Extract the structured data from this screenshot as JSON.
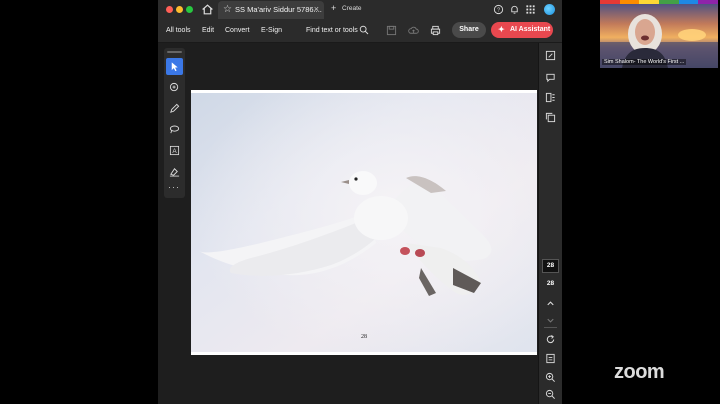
{
  "window": {
    "tab_title": "SS Ma'ariv Siddur 5786....",
    "create_label": "Create"
  },
  "toolbar": {
    "menus": [
      "All tools",
      "Edit",
      "Convert",
      "E-Sign"
    ],
    "find_label": "Find text or tools",
    "share_label": "Share",
    "ai_label": "AI Assistant"
  },
  "left_tools": [
    "select-icon",
    "add-comment-icon",
    "highlight-icon",
    "draw-icon",
    "text-box-icon",
    "fill-sign-icon",
    "more-tools-icon"
  ],
  "right_tools": [
    "edit-pdf-icon",
    "comments-icon",
    "organize-pages-icon",
    "copy-icon",
    "rotate-icon",
    "save-icon",
    "zoom-in-icon",
    "zoom-out-icon"
  ],
  "document": {
    "page_label": "28",
    "current_page": "28",
    "total_pages": "28"
  },
  "zoom": {
    "speaker_name": "Sim Shalom- The World's First ...",
    "logo": "zoom"
  },
  "colors": {
    "accent": "#3b78e7",
    "ai_button": "#e8484f",
    "app_bg": "#1e1e1e",
    "toolbar_bg": "#2b2b2b"
  }
}
